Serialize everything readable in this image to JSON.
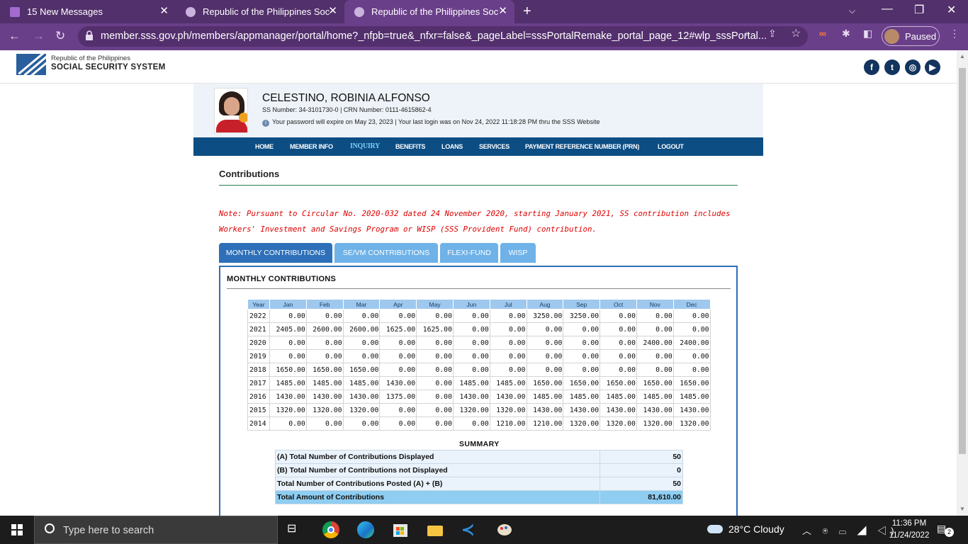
{
  "browser": {
    "tabs": [
      {
        "title": "15 New Messages",
        "active": false
      },
      {
        "title": "Republic of the Philippines Social",
        "active": false
      },
      {
        "title": "Republic of the Philippines Social",
        "active": true
      }
    ],
    "url": "member.sss.gov.ph/members/appmanager/portal/home?_nfpb=true&_nfxr=false&_pageLabel=sssPortalRemake_portal_page_12#wlp_sssPortal...",
    "profile_status": "Paused"
  },
  "site": {
    "org_small": "Republic of the Philippines",
    "org_big": "SOCIAL SECURITY SYSTEM",
    "social": [
      "facebook-icon",
      "twitter-icon",
      "instagram-icon",
      "youtube-icon"
    ]
  },
  "profile": {
    "name": "CELESTINO, ROBINIA ALFONSO",
    "numbers": "SS Number: 34-3101730-0  |  CRN Number: 0111-4615862-4",
    "password_info": "Your password will expire on May 23, 2023  |  Your last login was on Nov 24, 2022 11:18:28 PM thru the SSS Website"
  },
  "menu": {
    "items": [
      "HOME",
      "MEMBER INFO",
      "INQUIRY",
      "BENEFITS",
      "LOANS",
      "SERVICES",
      "PAYMENT REFERENCE NUMBER (PRN)",
      "LOGOUT"
    ],
    "selected": "INQUIRY"
  },
  "content": {
    "title": "Contributions",
    "note": "Note: Pursuant to Circular No. 2020-032 dated 24 November 2020, starting January 2021, SS contribution includes Workers' Investment and Savings Program or WISP (SSS Provident Fund) contribution.",
    "tabs": [
      "MONTHLY CONTRIBUTIONS",
      "SE/VM CONTRIBUTIONS",
      "FLEXI-FUND",
      "WISP"
    ],
    "active_tab": "MONTHLY CONTRIBUTIONS",
    "panel_title": "MONTHLY CONTRIBUTIONS",
    "table": {
      "headers": [
        "Year",
        "Jan",
        "Feb",
        "Mar",
        "Apr",
        "May",
        "Jun",
        "Jul",
        "Aug",
        "Sep",
        "Oct",
        "Nov",
        "Dec"
      ],
      "rows": [
        [
          "2022",
          "0.00",
          "0.00",
          "0.00",
          "0.00",
          "0.00",
          "0.00",
          "0.00",
          "3250.00",
          "3250.00",
          "0.00",
          "0.00",
          "0.00"
        ],
        [
          "2021",
          "2405.00",
          "2600.00",
          "2600.00",
          "1625.00",
          "1625.00",
          "0.00",
          "0.00",
          "0.00",
          "0.00",
          "0.00",
          "0.00",
          "0.00"
        ],
        [
          "2020",
          "0.00",
          "0.00",
          "0.00",
          "0.00",
          "0.00",
          "0.00",
          "0.00",
          "0.00",
          "0.00",
          "0.00",
          "2400.00",
          "2400.00"
        ],
        [
          "2019",
          "0.00",
          "0.00",
          "0.00",
          "0.00",
          "0.00",
          "0.00",
          "0.00",
          "0.00",
          "0.00",
          "0.00",
          "0.00",
          "0.00"
        ],
        [
          "2018",
          "1650.00",
          "1650.00",
          "1650.00",
          "0.00",
          "0.00",
          "0.00",
          "0.00",
          "0.00",
          "0.00",
          "0.00",
          "0.00",
          "0.00"
        ],
        [
          "2017",
          "1485.00",
          "1485.00",
          "1485.00",
          "1430.00",
          "0.00",
          "1485.00",
          "1485.00",
          "1650.00",
          "1650.00",
          "1650.00",
          "1650.00",
          "1650.00"
        ],
        [
          "2016",
          "1430.00",
          "1430.00",
          "1430.00",
          "1375.00",
          "0.00",
          "1430.00",
          "1430.00",
          "1485.00",
          "1485.00",
          "1485.00",
          "1485.00",
          "1485.00"
        ],
        [
          "2015",
          "1320.00",
          "1320.00",
          "1320.00",
          "0.00",
          "0.00",
          "1320.00",
          "1320.00",
          "1430.00",
          "1430.00",
          "1430.00",
          "1430.00",
          "1430.00"
        ],
        [
          "2014",
          "0.00",
          "0.00",
          "0.00",
          "0.00",
          "0.00",
          "0.00",
          "1210.00",
          "1210.00",
          "1320.00",
          "1320.00",
          "1320.00",
          "1320.00"
        ]
      ]
    },
    "summary": {
      "title": "SUMMARY",
      "rows": [
        {
          "label": "(A) Total Number of Contributions Displayed",
          "value": "50"
        },
        {
          "label": "(B) Total Number of Contributions not Displayed",
          "value": "0"
        },
        {
          "label": "Total Number of Contributions Posted (A) + (B)",
          "value": "50"
        },
        {
          "label": "Total Amount of Contributions",
          "value": "81,610.00"
        }
      ]
    }
  },
  "taskbar": {
    "search_placeholder": "Type here to search",
    "weather": "28°C  Cloudy",
    "time": "11:36 PM",
    "date": "11/24/2022",
    "notifications": "2"
  },
  "colors": {
    "browser_frame": "#52306b",
    "menu_bar": "#0c4d84",
    "active_tab": "#2d6fb8",
    "inactive_tab": "#6fb2e8",
    "note_text": "#dd0000"
  }
}
